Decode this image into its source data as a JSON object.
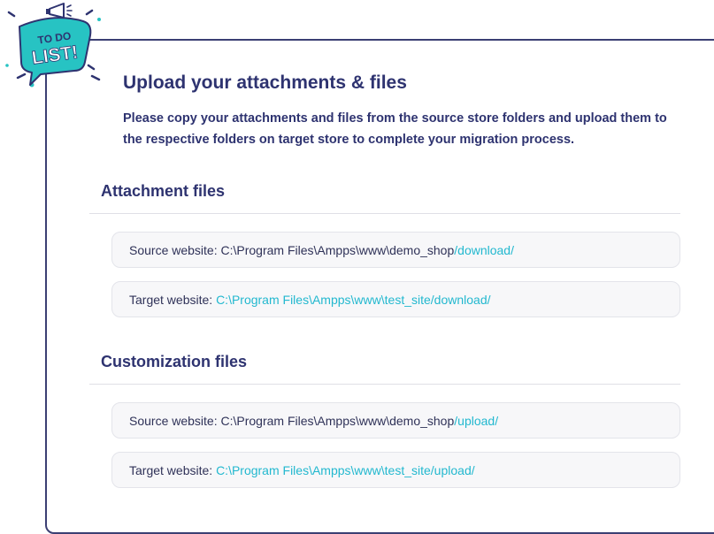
{
  "badge": {
    "line1": "TO DO",
    "line2": "LIST!"
  },
  "header": {
    "title": "Upload your attachments & files",
    "description": "Please copy your attachments and files from the source store folders and upload them to the respective folders on target store to complete your migration process."
  },
  "sections": [
    {
      "title": "Attachment files",
      "source": {
        "label": "Source website:",
        "path": "C:\\Program Files\\Ampps\\www\\demo_shop",
        "folder": "/download/"
      },
      "target": {
        "label": "Target website:",
        "path": "C:\\Program Files\\Ampps\\www\\test_site/download/"
      }
    },
    {
      "title": "Customization files",
      "source": {
        "label": "Source website:",
        "path": "C:\\Program Files\\Ampps\\www\\demo_shop",
        "folder": "/upload/"
      },
      "target": {
        "label": "Target website:",
        "path": "C:\\Program Files\\Ampps\\www\\test_site/upload/"
      }
    }
  ],
  "colors": {
    "navy": "#2e3370",
    "accent": "#22b8cf",
    "badge": "#27c3c3"
  }
}
